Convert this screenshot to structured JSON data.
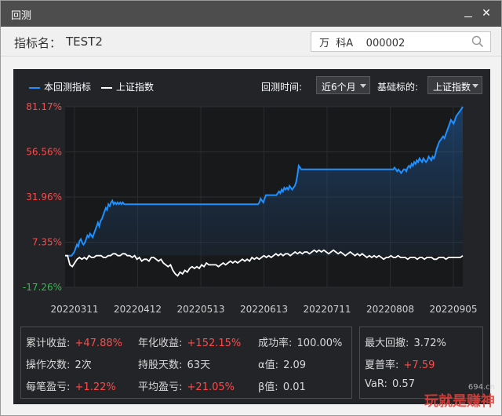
{
  "window": {
    "title": "回测"
  },
  "namebar": {
    "label": "指标名：",
    "value": "TEST2",
    "search_value": "万  科A    000002"
  },
  "legend": {
    "strategy": "本回测指标",
    "benchmark": "上证指数"
  },
  "controls": {
    "period_label": "回测时间:",
    "period_value": "近6个月",
    "benchmark_label": "基础标的:",
    "benchmark_value": "上证指数"
  },
  "colors": {
    "strategy": "#1e90ff",
    "benchmark": "#ffffff",
    "positive": "#ff4a4a",
    "background": "#232427"
  },
  "chart_data": {
    "type": "line",
    "y_ticks": [
      "81.17%",
      "56.56%",
      "31.96%",
      "7.35%",
      "-17.26%"
    ],
    "y_tick_values": [
      81.17,
      56.56,
      31.96,
      7.35,
      -17.26
    ],
    "ylim": [
      -17.26,
      81.17
    ],
    "x_ticks": [
      "20220311",
      "20220412",
      "20220513",
      "20220613",
      "20220711",
      "20220808",
      "20220905"
    ],
    "series": [
      {
        "name": "本回测指标",
        "values": [
          0,
          0,
          0,
          0,
          0,
          0,
          1,
          2,
          4,
          6,
          5,
          8,
          9,
          7,
          6,
          7,
          9,
          11,
          10,
          12,
          11,
          10,
          12,
          14,
          16,
          18,
          16,
          19,
          20,
          22,
          24,
          26,
          25,
          28,
          27,
          29,
          30,
          28,
          29,
          28,
          29,
          28,
          29,
          28,
          29,
          28,
          28,
          28,
          28,
          28,
          28,
          28,
          28,
          28,
          28,
          28,
          28,
          28,
          28,
          28,
          28,
          28,
          28,
          28,
          28,
          28,
          28,
          28,
          28,
          28,
          28,
          28,
          28,
          28,
          28,
          28,
          28,
          28,
          28,
          28,
          28,
          28,
          28,
          28,
          28,
          28,
          28,
          28,
          28,
          28,
          28,
          28,
          28,
          28,
          28,
          28,
          28,
          28,
          28,
          28,
          28,
          28,
          28,
          28,
          28,
          28,
          28,
          28,
          28,
          28,
          28,
          28,
          28,
          28,
          28,
          28,
          28,
          28,
          28,
          28,
          28,
          28,
          28,
          28,
          28,
          28,
          28,
          28,
          28,
          28,
          28,
          28,
          28,
          28,
          28,
          28,
          28,
          28,
          28,
          28,
          28,
          28,
          28,
          28,
          28,
          28,
          28,
          28,
          29,
          31,
          30,
          29,
          31,
          33,
          33,
          33,
          33,
          33,
          33,
          33,
          33,
          33,
          34,
          35,
          34,
          36,
          35,
          37,
          36,
          37,
          36,
          38,
          37,
          36,
          37,
          38,
          40,
          44,
          49,
          48,
          47,
          47,
          47,
          47,
          47,
          47,
          47,
          47,
          47,
          47,
          47,
          47,
          47,
          47,
          47,
          47,
          47,
          47,
          47,
          47,
          47,
          47,
          47,
          47,
          47,
          47,
          47,
          47,
          47,
          47,
          47,
          47,
          47,
          47,
          47,
          47,
          47,
          47,
          47,
          47,
          47,
          47,
          47,
          47,
          47,
          47,
          47,
          47,
          47,
          47,
          47,
          47,
          47,
          47,
          47,
          47,
          47,
          47,
          47,
          47,
          47,
          47,
          47,
          47,
          47,
          47,
          47,
          47,
          47,
          47,
          47,
          48,
          47,
          46,
          47,
          46,
          45,
          46,
          47,
          47,
          46,
          48,
          49,
          48,
          50,
          49,
          51,
          50,
          52,
          51,
          53,
          52,
          51,
          53,
          52,
          51,
          52,
          54,
          53,
          52,
          54,
          53,
          55,
          58,
          60,
          62,
          63,
          64,
          65,
          64,
          66,
          68,
          70,
          72,
          74,
          73,
          72,
          74,
          76,
          77,
          78,
          79,
          80,
          81.17
        ]
      },
      {
        "name": "上证指数",
        "values": [
          0,
          0,
          -5,
          -6,
          -4,
          -2,
          -1,
          -2,
          -1,
          -2,
          0,
          -1,
          -1,
          0,
          0,
          0,
          -1,
          -1,
          0,
          0,
          1,
          1,
          0,
          0,
          1,
          1,
          0,
          0,
          -1,
          0,
          -2,
          -1,
          -3,
          -2,
          -2,
          -3,
          -1,
          -1,
          -2,
          -3,
          -2,
          -4,
          -5,
          -6,
          -5,
          -8,
          -10,
          -11,
          -9,
          -10,
          -8,
          -9,
          -7,
          -6,
          -7,
          -6,
          -7,
          -5,
          -6,
          -4,
          -5,
          -5,
          -5,
          -5,
          -6,
          -5,
          -4,
          -5,
          -4,
          -3,
          -4,
          -3,
          -4,
          -3,
          -2,
          -3,
          -2,
          -3,
          -1,
          -2,
          -1,
          -2,
          -1,
          0,
          -1,
          0,
          -1,
          0,
          1,
          0,
          1,
          0,
          1,
          1,
          0,
          1,
          2,
          1,
          2,
          1,
          2,
          2,
          1,
          2,
          3,
          2,
          3,
          2,
          3,
          2,
          1,
          2,
          3,
          2,
          1,
          2,
          1,
          0,
          1,
          2,
          1,
          0,
          1,
          0,
          1,
          0,
          -1,
          0,
          -1,
          0,
          -1,
          0,
          -1,
          -2,
          -1,
          -1,
          0,
          -1,
          -1,
          0,
          -1,
          -1,
          -1,
          -2,
          -1,
          -1,
          -1,
          -2,
          -1,
          -1,
          -2,
          -1,
          -1,
          -1,
          -2,
          -2,
          -1,
          -1,
          -1,
          -2,
          -1,
          -1,
          -1,
          -1,
          -1,
          -1,
          0
        ]
      }
    ]
  },
  "stats": {
    "cumulative_label": "累计收益:",
    "cumulative_value": "+47.88%",
    "annual_label": "年化收益:",
    "annual_value": "+152.15%",
    "success_label": "成功率:",
    "success_value": "100.00%",
    "trades_label": "操作次数:",
    "trades_value": "2次",
    "hold_label": "持股天数:",
    "hold_value": "63天",
    "alpha_label": "α值:",
    "alpha_value": "2.09",
    "per_trade_label": "每笔盈亏:",
    "per_trade_value": "+1.22%",
    "avg_label": "平均盈亏:",
    "avg_value": "+21.05%",
    "beta_label": "β值:",
    "beta_value": "0.01",
    "max_dd_label": "最大回撤:",
    "max_dd_value": "3.72%",
    "sharpe_label": "夏普率:",
    "sharpe_value": "+7.59",
    "var_label": "VaR:",
    "var_value": "0.57"
  },
  "watermark": {
    "main": "玩就是赚神",
    "small": "694.cn"
  }
}
